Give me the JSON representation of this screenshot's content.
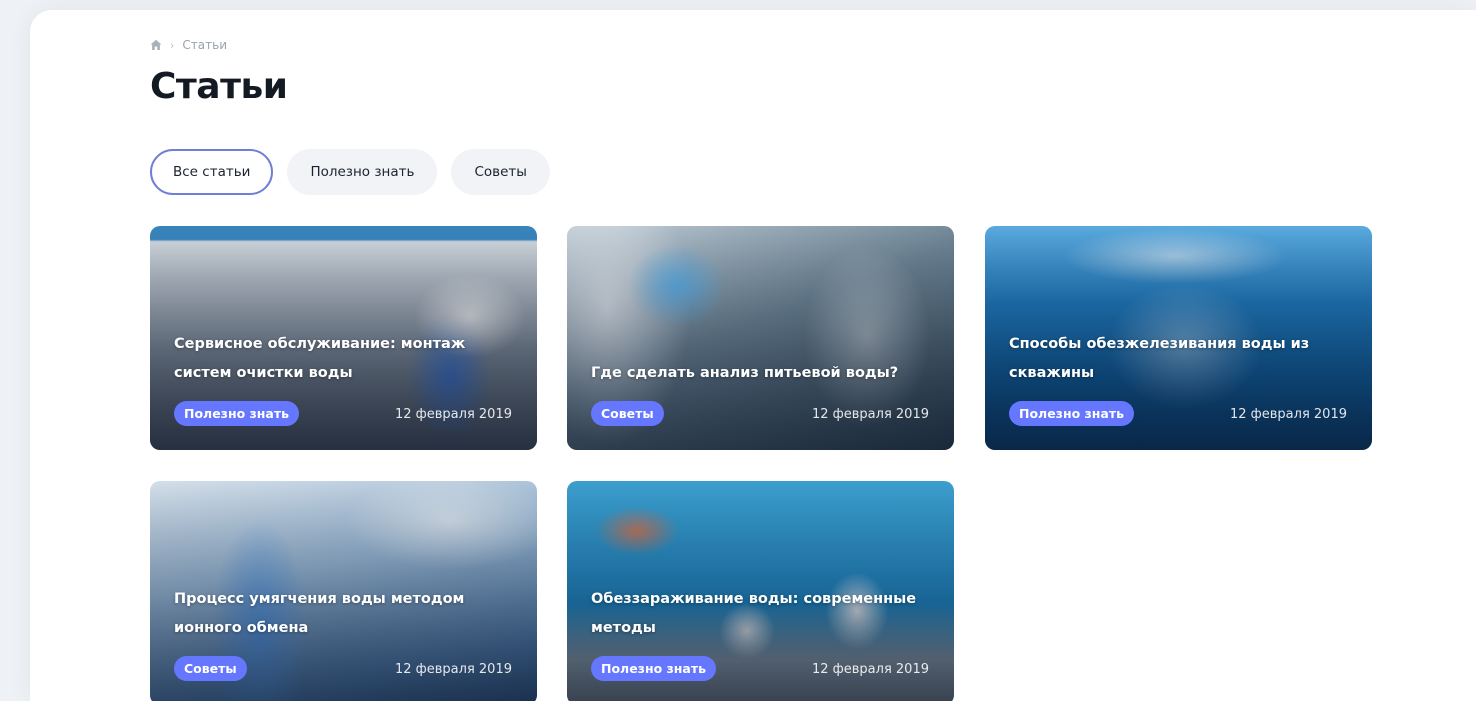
{
  "breadcrumb": {
    "home_icon": "home-icon",
    "separator": "›",
    "current": "Статьи"
  },
  "page_title": "Статьи",
  "tabs": [
    {
      "label": "Все статьи",
      "active": true
    },
    {
      "label": "Полезно знать",
      "active": false
    },
    {
      "label": "Советы",
      "active": false
    }
  ],
  "cards": [
    {
      "title": "Сервисное обслуживание: монтаж систем очистки воды",
      "tag": "Полезно знать",
      "date": "12 февраля 2019"
    },
    {
      "title": "Где сделать анализ питьевой воды?",
      "tag": "Советы",
      "date": "12 февраля 2019"
    },
    {
      "title": "Способы обезжелезивания воды из скважины",
      "tag": "Полезно знать",
      "date": "12 февраля 2019"
    },
    {
      "title": "Процесс умягчения воды методом ионного обмена",
      "tag": "Советы",
      "date": "12 февраля 2019"
    },
    {
      "title": "Обеззараживание воды: современные методы",
      "tag": "Полезно знать",
      "date": "12 февраля 2019"
    }
  ],
  "colors": {
    "accent": "#6576ff",
    "active_tab_border": "#6e7fd8",
    "title": "#141a24"
  }
}
